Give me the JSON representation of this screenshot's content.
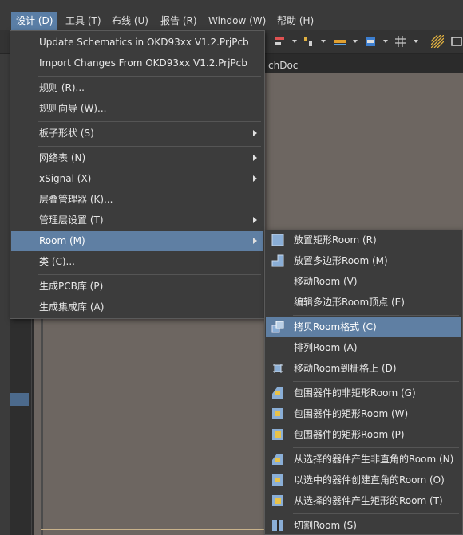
{
  "menubar": {
    "items": [
      {
        "label": "设计 (D)",
        "active": true
      },
      {
        "label": "工具 (T)"
      },
      {
        "label": "布线 (U)"
      },
      {
        "label": "报告 (R)"
      },
      {
        "label": "Window (W)"
      },
      {
        "label": "帮助 (H)"
      }
    ]
  },
  "document_tab": "chDoc",
  "design_menu": {
    "items": [
      {
        "label": "Update Schematics in OKD93xx V1.2.PrjPcb"
      },
      {
        "label": "Import Changes From OKD93xx V1.2.PrjPcb"
      },
      {
        "label": "规则 (R)..."
      },
      {
        "label": "规则向导 (W)..."
      },
      {
        "label": "板子形状 (S)",
        "submenu": true
      },
      {
        "label": "网络表 (N)",
        "submenu": true
      },
      {
        "label": "xSignal (X)",
        "submenu": true
      },
      {
        "label": "层叠管理器 (K)..."
      },
      {
        "label": "管理层设置 (T)",
        "submenu": true
      },
      {
        "label": "Room (M)",
        "submenu": true,
        "highlighted": true
      },
      {
        "label": "类 (C)..."
      },
      {
        "label": "生成PCB库 (P)"
      },
      {
        "label": "生成集成库 (A)"
      }
    ]
  },
  "room_submenu": {
    "items": [
      {
        "label": "放置矩形Room (R)",
        "icon": "rect-room-icon"
      },
      {
        "label": "放置多边形Room (M)",
        "icon": "polygon-room-icon"
      },
      {
        "label": "移动Room (V)"
      },
      {
        "label": "编辑多边形Room顶点 (E)"
      },
      {
        "label": "拷贝Room格式 (C)",
        "icon": "copy-room-format-icon",
        "highlighted": true
      },
      {
        "label": "排列Room (A)"
      },
      {
        "label": "移动Room到栅格上 (D)",
        "icon": "snap-grid-icon"
      },
      {
        "label": "包围器件的非矩形Room (G)",
        "icon": "nonrect-room-components-icon"
      },
      {
        "label": "包围器件的矩形Room (W)",
        "icon": "rect-room-components-icon"
      },
      {
        "label": "包围器件的矩形Room (P)",
        "icon": "rect-room-components-alt-icon"
      },
      {
        "label": "从选择的器件产生非直角的Room (N)",
        "icon": "nonorth-room-selected-icon"
      },
      {
        "label": "以选中的器件创建直角的Room (O)",
        "icon": "orth-room-selected-icon"
      },
      {
        "label": "从选择的器件产生矩形的Room (T)",
        "icon": "rect-room-selected-icon"
      },
      {
        "label": "切割Room (S)",
        "icon": "slice-room-icon"
      }
    ]
  },
  "colors": {
    "highlight": "#5f7fa3",
    "menu_bg": "#3c3c3c",
    "canvas": "#6d6661"
  }
}
